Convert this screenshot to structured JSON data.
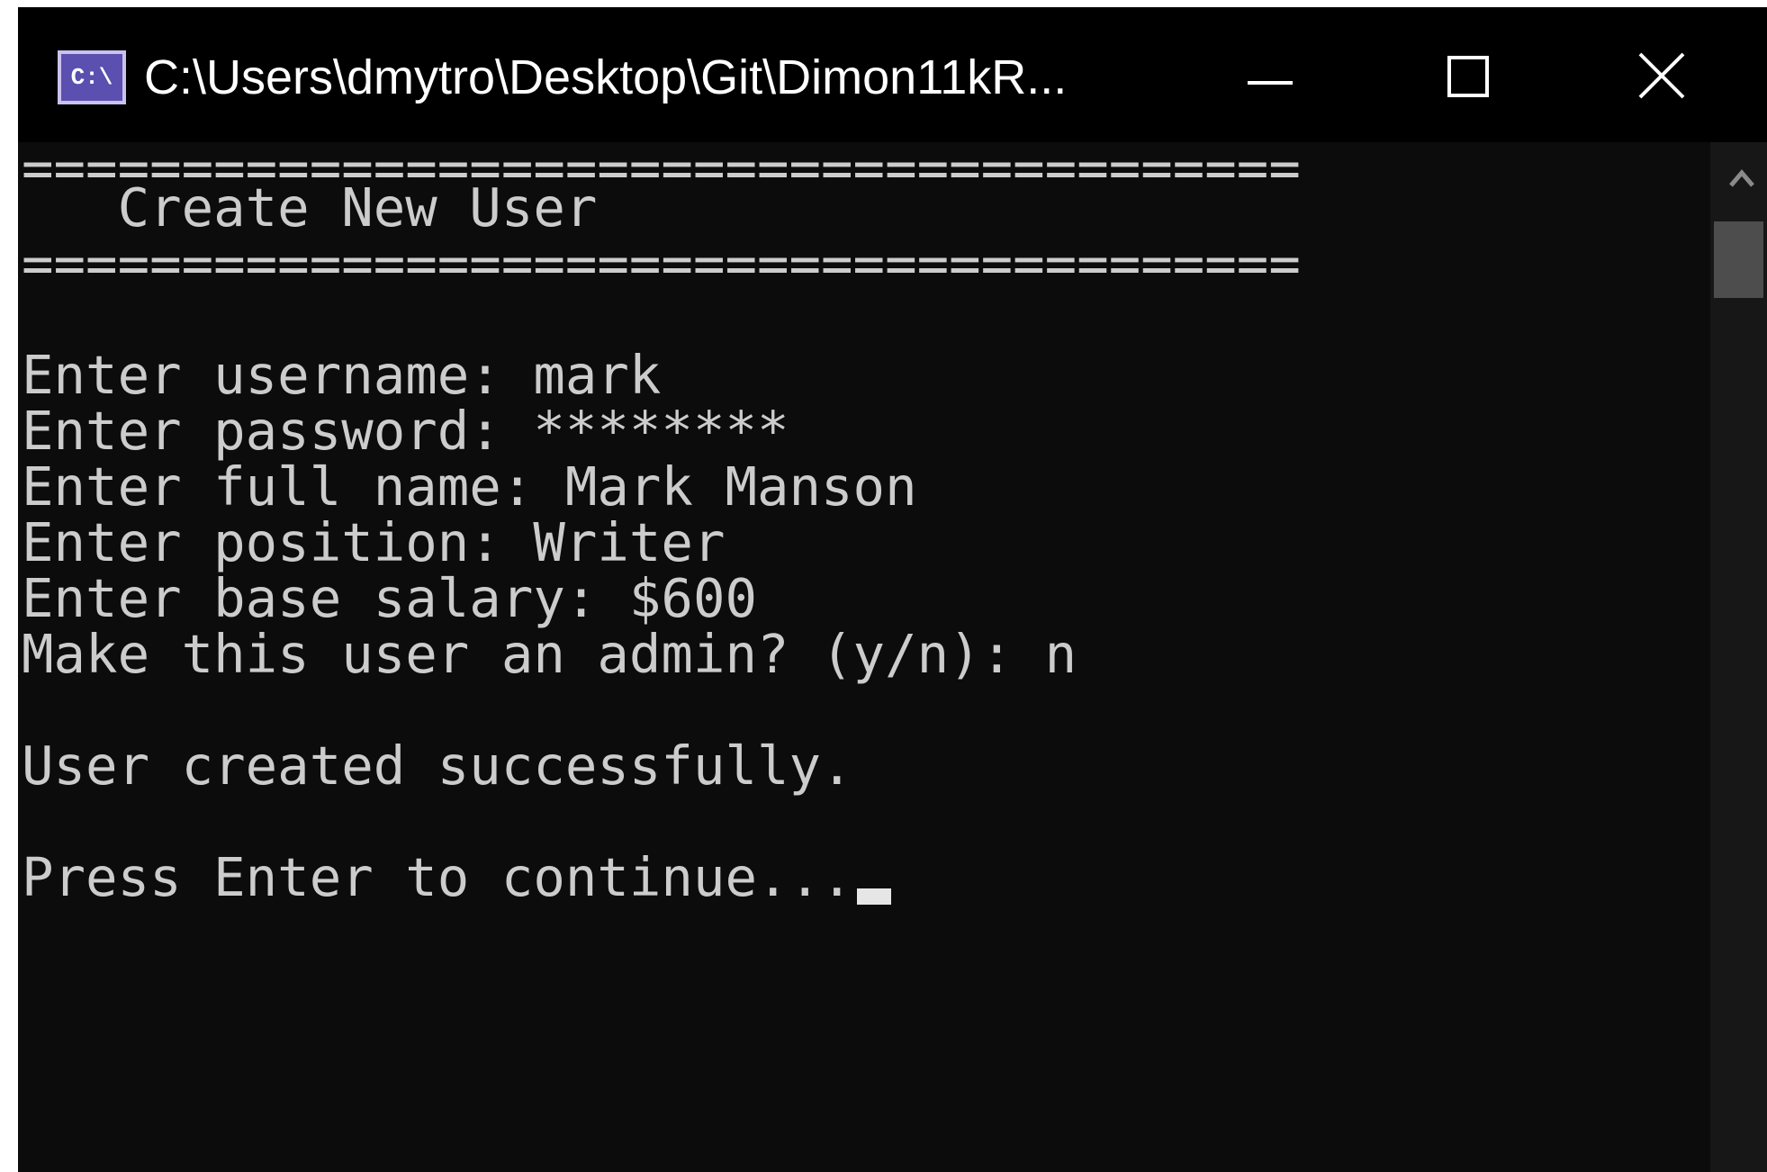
{
  "window": {
    "title": "C:\\Users\\dmytro\\Desktop\\Git\\Dimon11kR...",
    "icon_text": "C:\\"
  },
  "console": {
    "lines": [
      "========================================",
      "   Create New User",
      "========================================",
      "",
      "Enter username: mark",
      "Enter password: ********",
      "Enter full name: Mark Manson",
      "Enter position: Writer",
      "Enter base salary: $600",
      "Make this user an admin? (y/n): n",
      "",
      "User created successfully.",
      "",
      "Press Enter to continue..."
    ]
  },
  "colors": {
    "background": "#0c0c0c",
    "titlebar": "#000000",
    "text": "#cccccc",
    "icon": "#5b4fb0"
  },
  "icons": [
    "console-app-icon",
    "minimize-icon",
    "maximize-icon",
    "close-icon",
    "scroll-up-arrow-icon"
  ]
}
